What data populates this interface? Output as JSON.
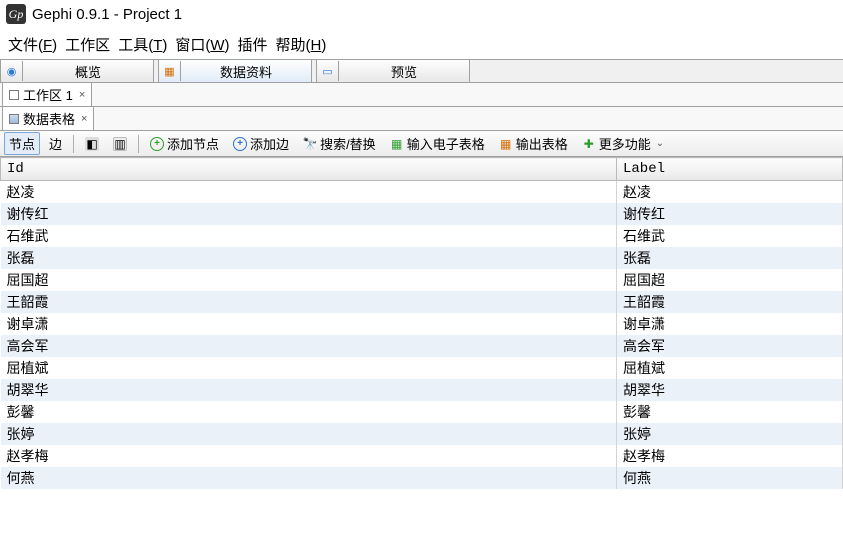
{
  "title": "Gephi 0.9.1 - Project 1",
  "menu": [
    "文件(F)",
    "工作区",
    "工具(T)",
    "窗口(W)",
    "插件",
    "帮助(H)"
  ],
  "views": {
    "overview": "概览",
    "datalab": "数据资料",
    "preview": "预览"
  },
  "workspace_tab": "工作区 1",
  "panel_tab": "数据表格",
  "toolbar": {
    "nodes": "节点",
    "edges": "边",
    "add_node": "添加节点",
    "add_edge": "添加边",
    "search": "搜索/替换",
    "import": "输入电子表格",
    "export": "输出表格",
    "more": "更多功能"
  },
  "columns": {
    "id": "Id",
    "label": "Label"
  },
  "rows": [
    {
      "id": "赵凌",
      "label": "赵凌"
    },
    {
      "id": "谢传红",
      "label": "谢传红"
    },
    {
      "id": "石维武",
      "label": "石维武"
    },
    {
      "id": "张磊",
      "label": "张磊"
    },
    {
      "id": "屈国超",
      "label": "屈国超"
    },
    {
      "id": "王韶霞",
      "label": "王韶霞"
    },
    {
      "id": "谢卓潇",
      "label": "谢卓潇"
    },
    {
      "id": "高会军",
      "label": "高会军"
    },
    {
      "id": "屈植斌",
      "label": "屈植斌"
    },
    {
      "id": "胡翠华",
      "label": "胡翠华"
    },
    {
      "id": "彭馨",
      "label": "彭馨"
    },
    {
      "id": "张婷",
      "label": "张婷"
    },
    {
      "id": "赵孝梅",
      "label": "赵孝梅"
    },
    {
      "id": "何燕",
      "label": "何燕"
    }
  ]
}
